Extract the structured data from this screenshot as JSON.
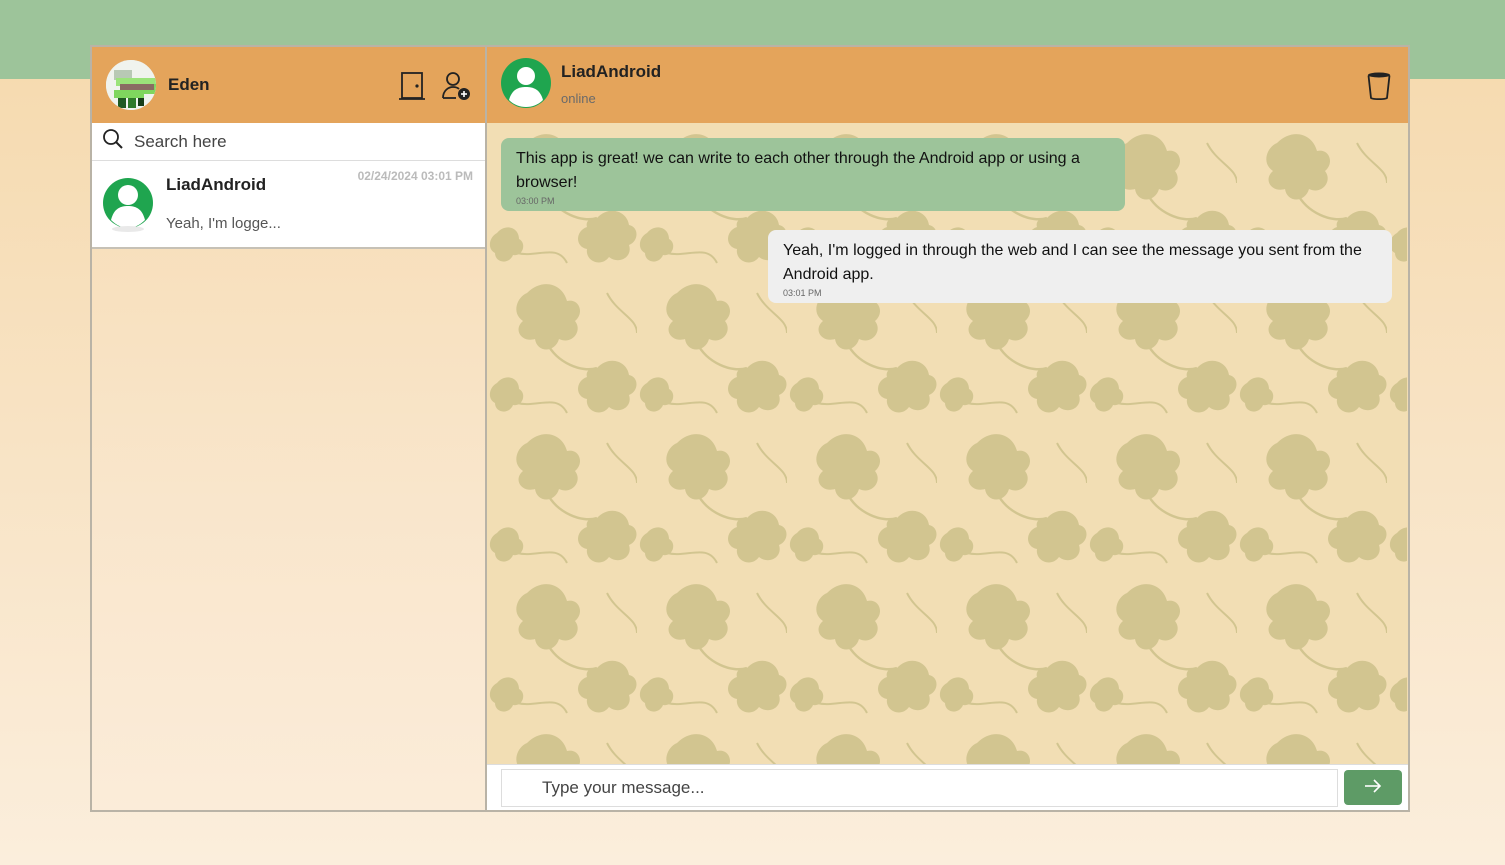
{
  "colors": {
    "header_orange": "#e4a45b",
    "top_band_green": "#9dc49a",
    "incoming_bubble": "#9dc49a",
    "outgoing_bubble": "#efefef",
    "send_button": "#5e9b66",
    "pattern_leaf": "#d2c590"
  },
  "sidebar": {
    "user_name": "Eden",
    "logout_icon": "door-icon",
    "add_contact_icon": "add-user-icon",
    "search": {
      "placeholder": "Search here",
      "value": ""
    },
    "contacts": [
      {
        "name": "LiadAndroid",
        "preview": "Yeah, I'm logge...",
        "date": "02/24/2024 03:01 PM"
      }
    ]
  },
  "chat": {
    "contact_name": "LiadAndroid",
    "status": "online",
    "delete_icon": "trash-icon",
    "messages": [
      {
        "direction": "incoming",
        "text": "This app is great! we can write to each other through the Android app or using a browser!",
        "time": "03:00 PM"
      },
      {
        "direction": "outgoing",
        "text": "Yeah, I'm logged in through the web and I can see the message you sent from the Android app.",
        "time": "03:01 PM"
      }
    ],
    "composer": {
      "placeholder": "Type your message...",
      "value": "",
      "send_icon": "arrow-right-icon"
    }
  }
}
